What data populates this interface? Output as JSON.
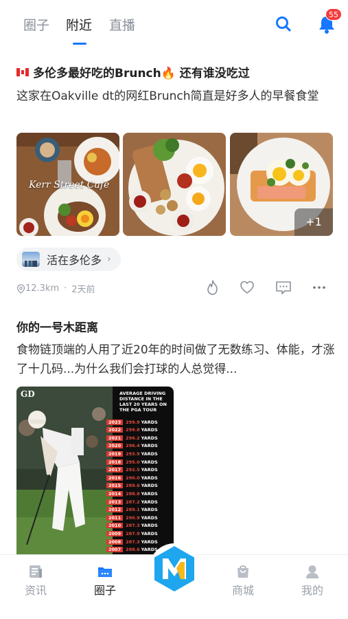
{
  "top_tabs": [
    "圈子",
    "附近",
    "直播"
  ],
  "active_tab": "附近",
  "notification_count": "55",
  "post1": {
    "title": "多伦多最好吃的Brunch🔥 还有谁没吃过",
    "body": "这家在Oakville dt的网红Brunch简直是好多人的早餐食堂",
    "photo_watermark": "Kerr Street Cafe",
    "more_photos": "+1",
    "circle_name": "活在多伦多",
    "distance": "12.3km",
    "time": "2天前"
  },
  "post2": {
    "title": "你的一号木距离",
    "body": "食物链顶端的人用了近20年的时间做了无数练习、体能，才涨了十几码...为什么我们会打球的人总觉得...",
    "image_logo": "GD",
    "image_heading": "AVERAGE DRIVING DISTANCE IN THE LAST 20 YEARS ON THE PGA TOUR",
    "yardage_table": [
      {
        "year": "2023",
        "yards": "299.9",
        "unit": "YARDS"
      },
      {
        "year": "2022",
        "yards": "299.8",
        "unit": "YARDS"
      },
      {
        "year": "2021",
        "yards": "296.2",
        "unit": "YARDS"
      },
      {
        "year": "2020",
        "yards": "296.4",
        "unit": "YARDS"
      },
      {
        "year": "2019",
        "yards": "293.9",
        "unit": "YARDS"
      },
      {
        "year": "2018",
        "yards": "295.0",
        "unit": "YARDS"
      },
      {
        "year": "2017",
        "yards": "292.5",
        "unit": "YARDS"
      },
      {
        "year": "2016",
        "yards": "290.0",
        "unit": "YARDS"
      },
      {
        "year": "2015",
        "yards": "289.6",
        "unit": "YARDS"
      },
      {
        "year": "2014",
        "yards": "288.8",
        "unit": "YARDS"
      },
      {
        "year": "2013",
        "yards": "287.2",
        "unit": "YARDS"
      },
      {
        "year": "2012",
        "yards": "289.1",
        "unit": "YARDS"
      },
      {
        "year": "2011",
        "yards": "290.9",
        "unit": "YARDS"
      },
      {
        "year": "2010",
        "yards": "287.3",
        "unit": "YARDS"
      },
      {
        "year": "2009",
        "yards": "287.9",
        "unit": "YARDS"
      },
      {
        "year": "2008",
        "yards": "287.3",
        "unit": "YARDS"
      },
      {
        "year": "2007",
        "yards": "288.6",
        "unit": "YARDS"
      }
    ]
  },
  "bottom_nav": [
    "资讯",
    "圈子",
    "商城",
    "我的"
  ],
  "bottom_nav_active": "圈子",
  "colors": {
    "accent": "#1677ff",
    "badge": "#f23d3d",
    "center_button": "#1ea6ee"
  }
}
